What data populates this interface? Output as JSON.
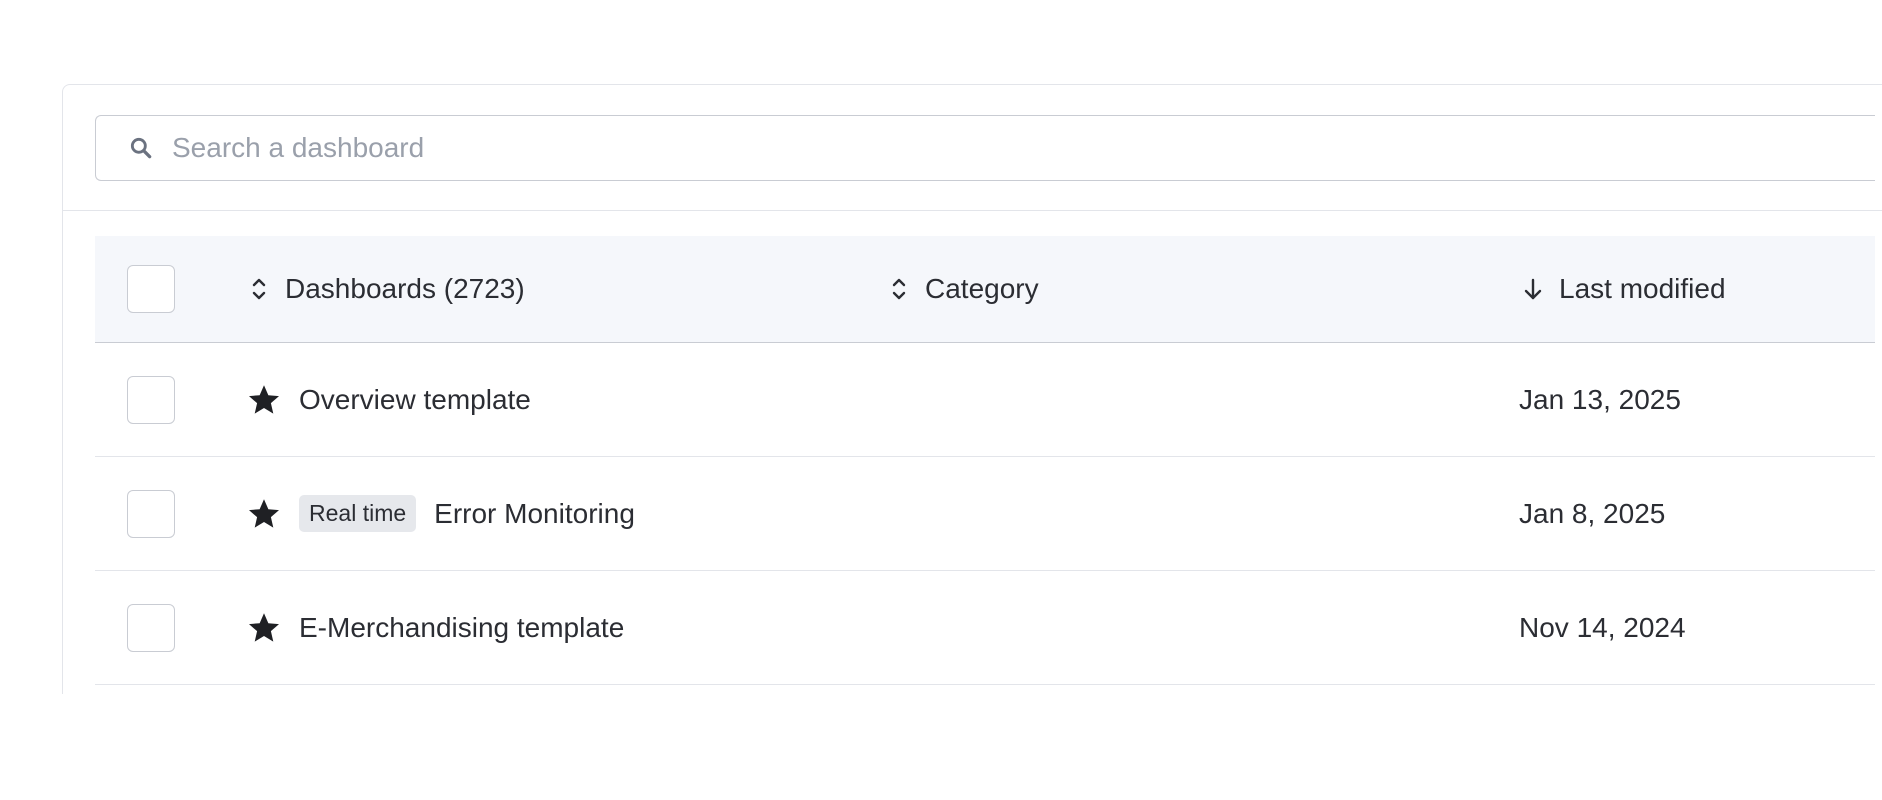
{
  "search": {
    "placeholder": "Search a dashboard",
    "value": ""
  },
  "table": {
    "columns": {
      "name": "Dashboards (2723)",
      "category": "Category",
      "last_modified": "Last modified"
    },
    "rows": [
      {
        "name": "Overview template",
        "badge": "",
        "category": "",
        "last_modified": "Jan 13, 2025",
        "starred": true
      },
      {
        "name": "Error Monitoring",
        "badge": "Real time",
        "category": "",
        "last_modified": "Jan 8, 2025",
        "starred": true
      },
      {
        "name": "E-Merchandising template",
        "badge": "",
        "category": "",
        "last_modified": "Nov 14, 2024",
        "starred": true
      }
    ]
  },
  "icons": {
    "search": "search-icon",
    "sort_name": "sort-icon",
    "sort_category": "sort-icon",
    "sort_last_modified": "arrow-down-icon",
    "star": "star-icon"
  }
}
